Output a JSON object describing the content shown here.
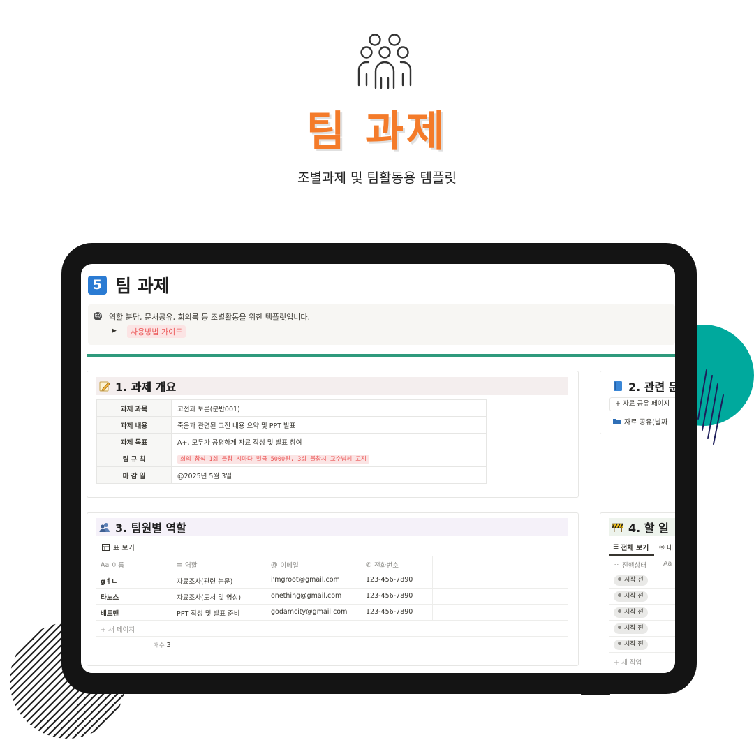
{
  "hero": {
    "title": "팀 과제",
    "subtitle": "조별과제 및 팀활동용 템플릿",
    "icon": "team-people-icon",
    "accent_color": "#f47b2a"
  },
  "page": {
    "badge": "5",
    "title": "팀 과제",
    "callout_text": "역할 분담, 문서공유, 회의록 등 조별활동을 위한 템플릿입니다.",
    "guide_link": "사용방법 가이드",
    "divider_color": "#2e9a7c"
  },
  "overview": {
    "heading": "1. 과제 개요",
    "rows": [
      {
        "key": "과제 과목",
        "value": "고전과 토론(분반001)"
      },
      {
        "key": "과제 내용",
        "value": "죽음과 관련된 고전 내용 요약 및 PPT 발표"
      },
      {
        "key": "과제 목표",
        "value": "A+, 모두가 공평하게 자료 작성 및 발표 참여"
      },
      {
        "key": "팀 규 칙",
        "value": "회의 참석 1회 불참 시마다 벌금 5000원, 3회 불참시 교수님께 고지"
      },
      {
        "key": "마 감 일",
        "value": "@2025년 5월 3일"
      }
    ]
  },
  "docs": {
    "heading": "2. 관련 문",
    "add_label": "+ 자료 공유 페이지",
    "folder_label": "자료 공유(날짜 "
  },
  "members": {
    "heading": "3. 팀원별 역할",
    "view_label": "표 보기",
    "columns": [
      {
        "prefix": "Aa",
        "label": "이름"
      },
      {
        "prefix": "≡",
        "label": "역할"
      },
      {
        "prefix": "@",
        "label": "이메일"
      },
      {
        "prefix": "✆",
        "label": "전화번호"
      }
    ],
    "rows": [
      {
        "name": "gㅕㄴ",
        "role": "자료조사(관련 논문)",
        "email": "i'mgroot@gmail.com",
        "phone": "123-456-7890"
      },
      {
        "name": "타노스",
        "role": "자료조사(도서 및 영상)",
        "email": "onething@gmail.com",
        "phone": "123-456-7890"
      },
      {
        "name": "배트맨",
        "role": "PPT 작성 및 발표 준비",
        "email": "godamcity@gmail.com",
        "phone": "123-456-7890"
      }
    ],
    "new_page": "+ 새 페이지",
    "count_label": "개수",
    "count_value": "3"
  },
  "todo": {
    "heading": "4. 할 일",
    "tab_all": "전체 보기",
    "tab_mine": "내",
    "col_status": "진행상태",
    "col_name": "Aa",
    "statuses": [
      "시작 전",
      "시작 전",
      "시작 전",
      "시작 전",
      "시작 전"
    ],
    "new_task": "+ 새 작업"
  }
}
